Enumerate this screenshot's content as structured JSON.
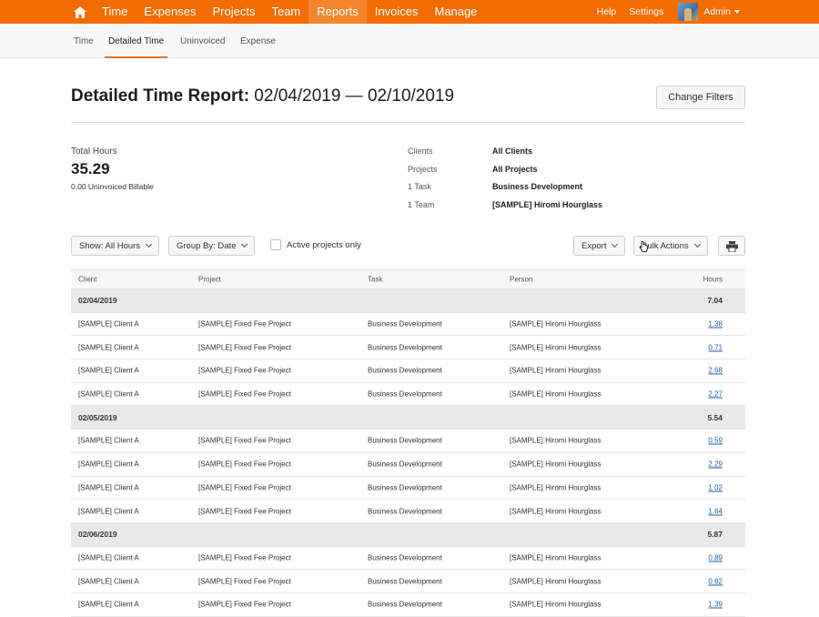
{
  "nav": {
    "items": [
      "Time",
      "Expenses",
      "Projects",
      "Team",
      "Reports",
      "Invoices",
      "Manage"
    ],
    "active": "Reports",
    "help": "Help",
    "settings": "Settings",
    "user": "Admin"
  },
  "subnav": {
    "items": [
      "Time",
      "Detailed Time",
      "Uninvoiced",
      "Expense"
    ],
    "active": "Detailed Time"
  },
  "header": {
    "title_bold": "Detailed Time Report:",
    "title_range": " 02/04/2019 — 02/10/2019",
    "change_filters": "Change Filters"
  },
  "summary": {
    "total_label": "Total Hours",
    "total_value": "35.29",
    "uninvoiced": "0.00 Uninvoiced Billable",
    "filters": [
      {
        "label": "Clients",
        "value": "All Clients"
      },
      {
        "label": "Projects",
        "value": "All Projects"
      },
      {
        "label": "1 Task",
        "value": "Business Development"
      },
      {
        "label": "1 Team",
        "value": "[SAMPLE] Hiromi Hourglass"
      }
    ]
  },
  "controls": {
    "show": "Show: All Hours",
    "group_by": "Group By: Date",
    "active_only": "Active projects only",
    "export": "Export",
    "bulk": "Bulk Actions"
  },
  "table": {
    "columns": [
      "Client",
      "Project",
      "Task",
      "Person",
      "Hours"
    ],
    "groups": [
      {
        "date": "02/04/2019",
        "total": "7.04",
        "rows": [
          [
            "[SAMPLE] Client A",
            "[SAMPLE] Fixed Fee Project",
            "Business Development",
            "[SAMPLE] Hiromi Hourglass",
            "1.38"
          ],
          [
            "[SAMPLE] Client A",
            "[SAMPLE] Fixed Fee Project",
            "Business Development",
            "[SAMPLE] Hiromi Hourglass",
            "0.71"
          ],
          [
            "[SAMPLE] Client A",
            "[SAMPLE] Fixed Fee Project",
            "Business Development",
            "[SAMPLE] Hiromi Hourglass",
            "2.68"
          ],
          [
            "[SAMPLE] Client A",
            "[SAMPLE] Fixed Fee Project",
            "Business Development",
            "[SAMPLE] Hiromi Hourglass",
            "2.27"
          ]
        ]
      },
      {
        "date": "02/05/2019",
        "total": "5.54",
        "rows": [
          [
            "[SAMPLE] Client A",
            "[SAMPLE] Fixed Fee Project",
            "Business Development",
            "[SAMPLE] Hiromi Hourglass",
            "0.59"
          ],
          [
            "[SAMPLE] Client A",
            "[SAMPLE] Fixed Fee Project",
            "Business Development",
            "[SAMPLE] Hiromi Hourglass",
            "2.29"
          ],
          [
            "[SAMPLE] Client A",
            "[SAMPLE] Fixed Fee Project",
            "Business Development",
            "[SAMPLE] Hiromi Hourglass",
            "1.02"
          ],
          [
            "[SAMPLE] Client A",
            "[SAMPLE] Fixed Fee Project",
            "Business Development",
            "[SAMPLE] Hiromi Hourglass",
            "1.64"
          ]
        ]
      },
      {
        "date": "02/06/2019",
        "total": "5.87",
        "rows": [
          [
            "[SAMPLE] Client A",
            "[SAMPLE] Fixed Fee Project",
            "Business Development",
            "[SAMPLE] Hiromi Hourglass",
            "0.89"
          ],
          [
            "[SAMPLE] Client A",
            "[SAMPLE] Fixed Fee Project",
            "Business Development",
            "[SAMPLE] Hiromi Hourglass",
            "0.82"
          ],
          [
            "[SAMPLE] Client A",
            "[SAMPLE] Fixed Fee Project",
            "Business Development",
            "[SAMPLE] Hiromi Hourglass",
            "1.39"
          ]
        ]
      }
    ]
  }
}
